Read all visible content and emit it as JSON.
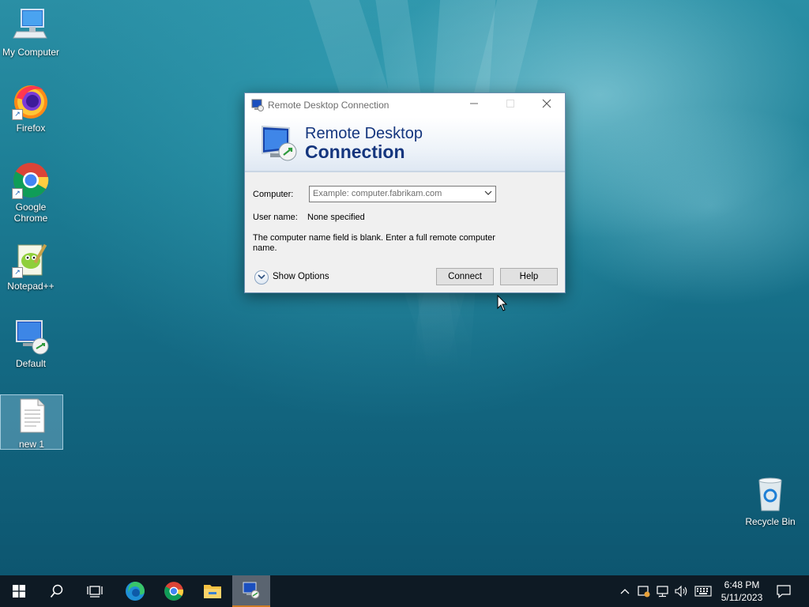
{
  "desktop": {
    "icons": [
      {
        "label": "My Computer"
      },
      {
        "label": "Firefox"
      },
      {
        "label": "Google Chrome"
      },
      {
        "label": "Notepad++"
      },
      {
        "label": "Default"
      },
      {
        "label": "new 1"
      },
      {
        "label": "Recycle Bin"
      }
    ]
  },
  "dialog": {
    "title": "Remote Desktop Connection",
    "banner_line1": "Remote Desktop",
    "banner_line2": "Connection",
    "computer_label": "Computer:",
    "computer_placeholder": "Example: computer.fabrikam.com",
    "username_label": "User name:",
    "username_value": "None specified",
    "message": "The computer name field is blank. Enter a full remote computer name.",
    "show_options": "Show Options",
    "connect": "Connect",
    "help": "Help"
  },
  "taskbar": {
    "time": "6:48 PM",
    "date": "5/11/2023",
    "accent": "#cc7a25"
  }
}
